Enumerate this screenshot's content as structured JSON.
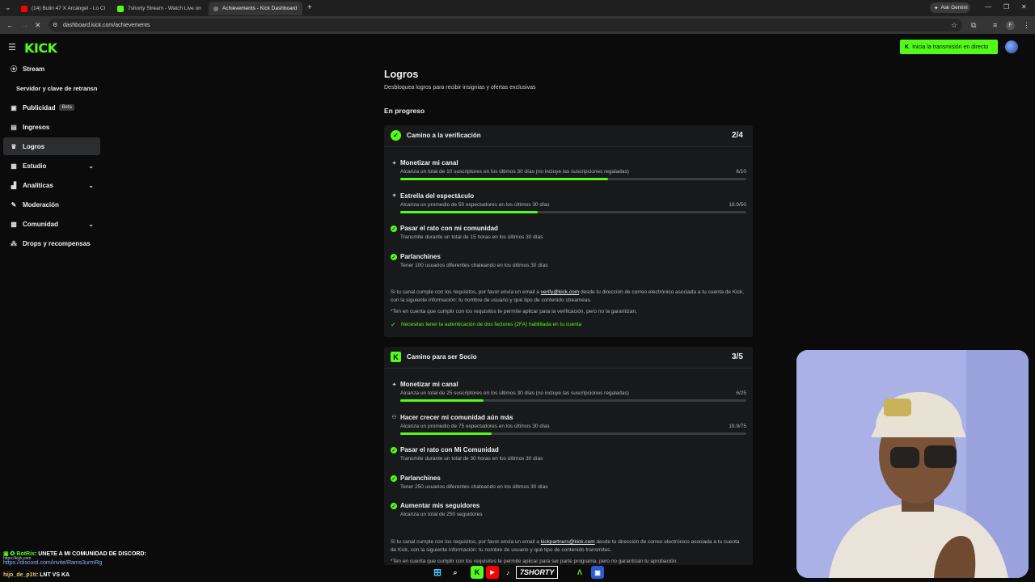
{
  "browser": {
    "tabs": [
      {
        "label": "(14) Bulin 47 X Arcángel - Lo Cl",
        "favicon_color": "#ff0000",
        "active": false
      },
      {
        "label": "7shorty Stream - Watch Live on",
        "favicon_color": "#53fc18",
        "active": false
      },
      {
        "label": "Achievements - Kick Dashboard",
        "favicon_color": "#888888",
        "active": true
      }
    ],
    "new_tab": "+",
    "ask_gemini": "Ask Gemini",
    "url": "dashboard.kick.com/achievements",
    "profile_initial": "F"
  },
  "header": {
    "logo": "KICK",
    "go_live_label": "Inicia la transmisión en directo"
  },
  "sidebar": {
    "items": [
      {
        "label": "Stream",
        "icon": "broadcast-icon",
        "glyph": "((•))"
      },
      {
        "label": "Servidor y clave de retransn",
        "icon": "",
        "glyph": ""
      },
      {
        "label": "Publicidad",
        "icon": "ad-icon",
        "glyph": "▣",
        "badge": "Beta"
      },
      {
        "label": "Ingresos",
        "icon": "revenue-icon",
        "glyph": "▤"
      },
      {
        "label": "Logros",
        "icon": "trophy-icon",
        "glyph": "🏆"
      },
      {
        "label": "Estudio",
        "icon": "studio-icon",
        "glyph": "▦",
        "chevron": true
      },
      {
        "label": "Analíticas",
        "icon": "analytics-icon",
        "glyph": "▁▃▅",
        "chevron": true
      },
      {
        "label": "Moderación",
        "icon": "wrench-icon",
        "glyph": "🔧"
      },
      {
        "label": "Comunidad",
        "icon": "community-icon",
        "glyph": "▩",
        "chevron": true
      },
      {
        "label": "Drops y recompensas",
        "icon": "drops-icon",
        "glyph": "⁂"
      }
    ]
  },
  "main": {
    "title": "Logros",
    "subtitle": "Desbloquea logros para recibir insignias y ofertas exclusivas",
    "section": "En progreso",
    "cards": [
      {
        "title": "Camino a la verificación",
        "count": "2/4",
        "items": [
          {
            "title": "Monetizar mi canal",
            "desc": "Alcanza un total de 10 suscriptores en los últimos 30 días (no incluye las suscripciones regaladas)",
            "value": "6/10",
            "progress": 0.6,
            "done": false
          },
          {
            "title": "Estrella del espectáculo",
            "desc": "Alcanza un promedio de 50 espectadores en los últimos 30 días",
            "value": "19.9/50",
            "progress": 0.398,
            "done": false
          },
          {
            "title": "Pasar el rato con mi comunidad",
            "desc": "Transmite durante un total de 15 horas en los últimos 30 días",
            "done": true
          },
          {
            "title": "Parlanchines",
            "desc": "Tener 100 usuarios diferentes chateando en los últimos 30 días",
            "done": true
          }
        ],
        "note_pre": "Si tu canal cumple con los requisitos, por favor envía un email a ",
        "note_email": "verify@kick.com",
        "note_post": " desde tu dirección de correo electrónico asociada a tu cuenta de Kick, con la siguiente información: tu nombre de usuario y qué tipo de contenido streameas.",
        "note_extra": "*Ten en cuenta que cumplir con los requisitos te permite aplicar para la verificación, pero no la garantizan.",
        "green_note": "Necesitas tener la autenticación de dos factores (2FA) habilitada en tu cuenta"
      },
      {
        "title": "Camino para ser Socio",
        "count": "3/5",
        "items": [
          {
            "title": "Monetizar mi canal",
            "desc": "Alcanza un total de 25 suscriptores en los últimos 30 días (no incluye las suscripciones regaladas)",
            "value": "6/25",
            "progress": 0.24,
            "done": false
          },
          {
            "title": "Hacer crecer mi comunidad aún más",
            "desc": "Alcanza un promedio de 75 espectadores en los últimos 30 días",
            "value": "19.9/75",
            "progress": 0.265,
            "done": false
          },
          {
            "title": "Pasar el rato con Mi Comunidad",
            "desc": "Transmite durante un total de 30 horas en los últimos 30 días",
            "done": true
          },
          {
            "title": "Parlanchines",
            "desc": "Tener 250 usuarios diferentes chateando en los últimos 30 días",
            "done": true
          },
          {
            "title": "Aumentar mis seguidores",
            "desc": "Alcanza un total de 250 seguidores",
            "done": true
          }
        ],
        "note_pre": "Si tu canal cumple con los requisitos, por favor envía un email a ",
        "note_email": "kickpartners@kick.com",
        "note_post": " desde tu dirección de correo electrónico asociada a tu cuenta de Kick, con la siguiente información: tu nombre de usuario y qué tipo de contenido transmites.",
        "note_extra": "*Ten en cuenta que cumplir con los requisitos te permite aplicar para ser parte programa, pero no garantizan tu aprobación."
      }
    ]
  },
  "chat": {
    "line1_user": "BotRix",
    "line1_text": ": UNETE A MI COMUNIDAD DE DISCORD:",
    "line1_link": "https://discord.com/invite/Rams3urmRg",
    "link_hover": "https://kick.com",
    "line2_user": "hijo_de_p1ti",
    "line2_text": ": LNT VS KA"
  },
  "taskbar": {
    "badge": "7SHORTY"
  },
  "colors": {
    "accent": "#53fc18",
    "background": "#0b0b0c",
    "card": "#18191a"
  }
}
